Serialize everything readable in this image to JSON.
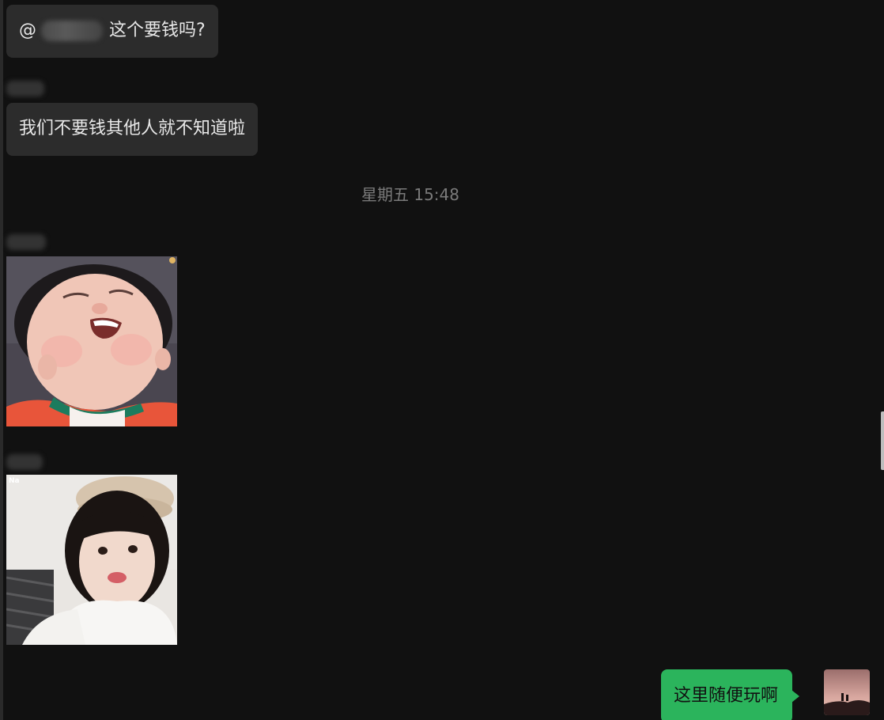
{
  "messages": {
    "msg1": {
      "prefix": "@",
      "text": "这个要钱吗?"
    },
    "msg2": {
      "text": "我们不要钱其他人就不知道啦"
    },
    "timestamp": "星期五 15:48",
    "sticker1": {
      "icon": "laughing-child-sticker"
    },
    "sticker2": {
      "icon": "girl-with-beret-sticker",
      "overlay_text": "Na"
    },
    "outgoing": {
      "text": "这里随便玩啊"
    }
  },
  "colors": {
    "background": "#111111",
    "incoming_bubble": "#2c2c2c",
    "outgoing_bubble": "#2bb45c",
    "timestamp_text": "#7a7a7a"
  }
}
